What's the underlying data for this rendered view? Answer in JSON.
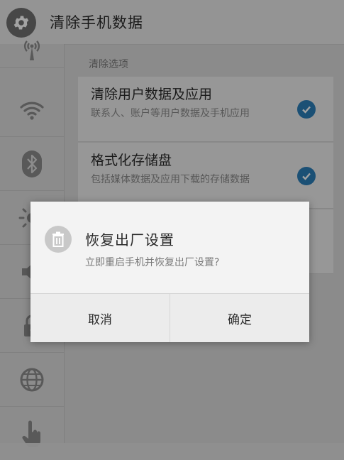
{
  "header": {
    "title": "清除手机数据",
    "icon": "gear-icon"
  },
  "rail": {
    "icons": [
      "broadcast-icon",
      "wifi-icon",
      "bluetooth-icon",
      "brightness-icon",
      "volume-icon",
      "lock-icon",
      "globe-icon",
      "hand-icon"
    ]
  },
  "main": {
    "section_title": "清除选项",
    "options": [
      {
        "title": "清除用户数据及应用",
        "desc": "联系人、账户等用户数据及手机应用",
        "checked": true
      },
      {
        "title": "格式化存储盘",
        "desc": "包括媒体数据及应用下载的存储数据",
        "checked": true
      }
    ]
  },
  "dialog": {
    "title": "恢复出厂设置",
    "message": "立即重启手机并恢复出厂设置?",
    "cancel": "取消",
    "confirm": "确定",
    "icon": "trash-icon"
  },
  "colors": {
    "accent": "#2b7db8",
    "scrim": "rgba(0,0,0,0.36)"
  }
}
